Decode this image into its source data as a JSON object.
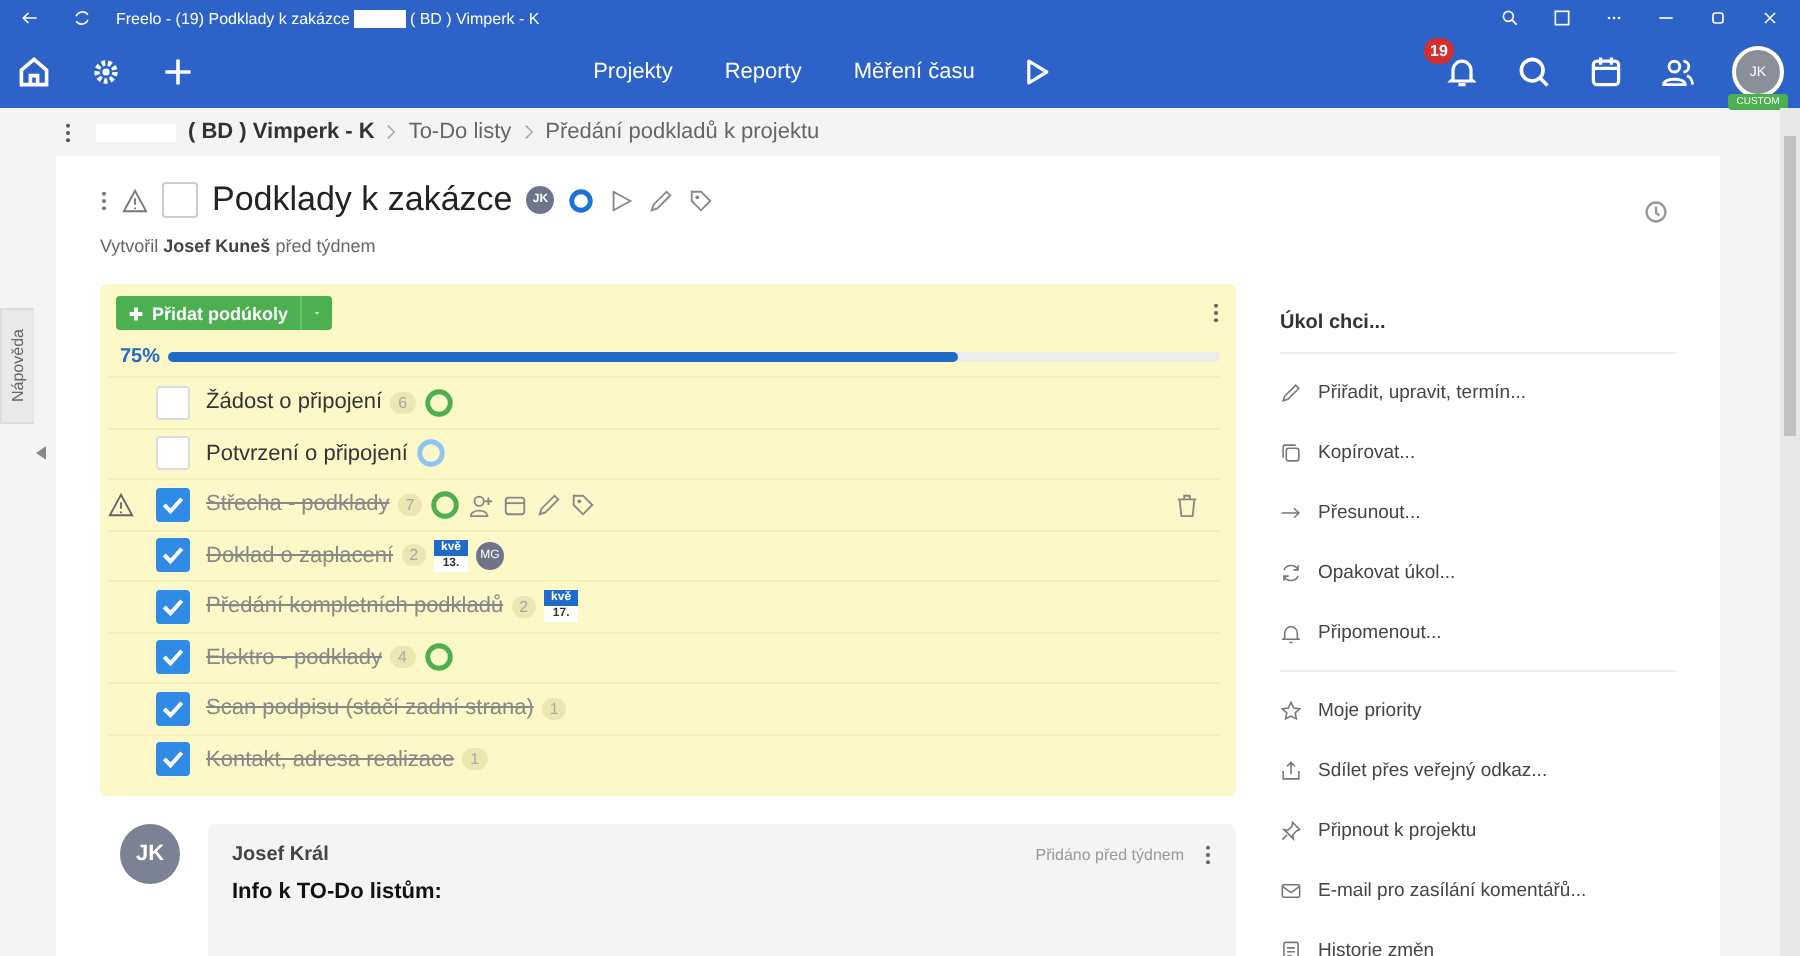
{
  "window": {
    "title_before": "Freelo - (19) Podklady k zakázce",
    "title_after": "( BD ) Vimperk - K"
  },
  "nav": {
    "links": [
      "Projekty",
      "Reporty",
      "Měření času"
    ],
    "notifications": "19",
    "avatar": "JK",
    "avatar_badge": "CUSTOM"
  },
  "breadcrumb": [
    "( BD ) Vimperk - K",
    "To-Do listy",
    "Předání podkladů k projektu"
  ],
  "help_tab": "Nápověda",
  "task": {
    "title": "Podklady k zakázce",
    "checked": false,
    "assignee": "JK",
    "created_label": "Vytvořil",
    "author": "Josef Kuneš",
    "created_when": "před týdnem"
  },
  "subtasks": {
    "add_button": "Přidat podúkoly",
    "progress_label": "75%",
    "level": 0.75,
    "items": [
      {
        "name": "Žádost o připojení",
        "count": "6",
        "checked": false,
        "color": "#4caf50",
        "warning": false,
        "hovered": false
      },
      {
        "name": "Potvrzení o připojení",
        "checked": false,
        "color": "#90c4f4",
        "warning": false,
        "hovered": false
      },
      {
        "name": "Střecha - podklady",
        "count": "7",
        "checked": true,
        "color": "#4caf50",
        "warning": true,
        "hovered": true
      },
      {
        "name": "Doklad o zaplacení",
        "count": "2",
        "checked": true,
        "date": {
          "month": "kvě",
          "day": "13."
        },
        "avatar": "MG",
        "warning": false,
        "hovered": false
      },
      {
        "name": "Předání kompletních podkladů",
        "count": "2",
        "checked": true,
        "date": {
          "month": "kvě",
          "day": "17."
        },
        "warning": false,
        "hovered": false
      },
      {
        "name": "Elektro - podklady",
        "count": "4",
        "checked": true,
        "color": "#4caf50",
        "warning": false,
        "hovered": false
      },
      {
        "name": "Scan podpisu (stačí zadní strana)",
        "count": "1",
        "checked": true,
        "warning": false,
        "hovered": false
      },
      {
        "name": "Kontakt, adresa realizace",
        "count": "1",
        "checked": true,
        "warning": false,
        "hovered": false
      }
    ]
  },
  "comment": {
    "avatar": "JK",
    "author": "Josef Král",
    "when": "Přidáno před týdnem",
    "heading": "Info k TO-Do listům:"
  },
  "actions": {
    "title": "Úkol chci...",
    "groups": [
      [
        "Přiřadit, upravit, termín...",
        "Kopírovat...",
        "Přesunout...",
        "Opakovat úkol...",
        "Připomenout..."
      ],
      [
        "Moje priority",
        "Sdílet přes veřejný odkaz...",
        "Připnout k projektu",
        "E-mail pro zasílání komentářů...",
        "Historie změn"
      ]
    ]
  }
}
